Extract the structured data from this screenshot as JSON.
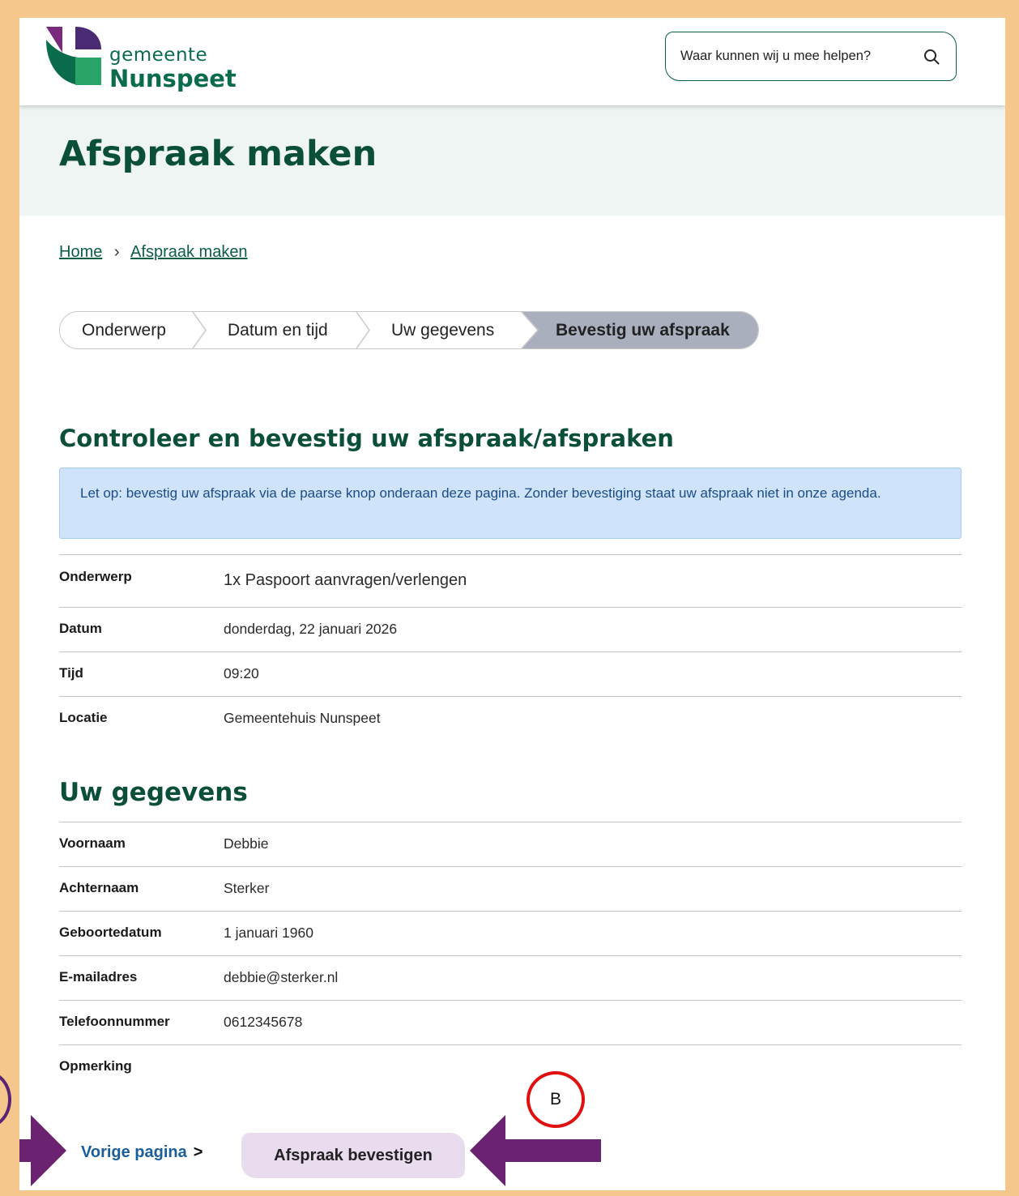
{
  "site": {
    "logo_small": "gemeente",
    "logo_big": "Nunspeet"
  },
  "search": {
    "placeholder": "Waar kunnen wij u mee helpen?"
  },
  "hero": {
    "title": "Afspraak maken"
  },
  "breadcrumb": {
    "items": [
      "Home",
      "Afspraak maken"
    ],
    "separator": "›"
  },
  "steps": {
    "items": [
      "Onderwerp",
      "Datum en tijd",
      "Uw gegevens",
      "Bevestig uw afspraak"
    ],
    "active_index": 3
  },
  "confirm_section": {
    "title": "Controleer en bevestig uw afspraak/afspraken",
    "notice": "Let op: bevestig uw afspraak via de paarse knop onderaan deze pagina. Zonder bevestiging staat uw afspraak niet in onze agenda.",
    "rows": [
      {
        "label": "Onderwerp",
        "value": "1x Paspoort aanvragen/verlengen"
      },
      {
        "label": "Datum",
        "value": "donderdag, 22 januari 2026"
      },
      {
        "label": "Tijd",
        "value": "09:20"
      },
      {
        "label": "Locatie",
        "value": "Gemeentehuis Nunspeet"
      }
    ]
  },
  "details_section": {
    "title": "Uw gegevens",
    "rows": [
      {
        "label": "Voornaam",
        "value": "Debbie"
      },
      {
        "label": "Achternaam",
        "value": "Sterker"
      },
      {
        "label": "Geboortedatum",
        "value": "1 januari 1960"
      },
      {
        "label": "E-mailadres",
        "value": "debbie@sterker.nl"
      },
      {
        "label": "Telefoonnummer",
        "value": "0612345678"
      },
      {
        "label": "Opmerking",
        "value": ""
      }
    ]
  },
  "actions": {
    "prev_label": "Vorige pagina",
    "prev_chevron": ">",
    "confirm_label": "Afspraak bevestigen"
  },
  "annotations": {
    "marker_b": "B",
    "arrow_color": "#6b2371",
    "marker_b_color": "#e01010"
  },
  "colors": {
    "brand_green": "#0b5e43",
    "hero_bg": "#eef5f2",
    "active_step": "#a9afbd",
    "notice_bg": "#cfe4fb",
    "confirm_bg": "#e9dcef",
    "frame": "#f5c78c"
  }
}
